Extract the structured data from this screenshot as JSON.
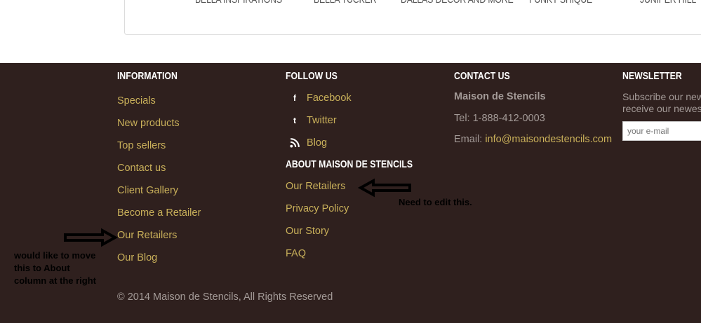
{
  "brands": [
    "BELLA INSPIRATIONS",
    "BELLA TUCKER",
    "DALLAS DECOR AND MORE",
    "FUNKY SHIQUE",
    "JUNIPER HILL"
  ],
  "information": {
    "title": "INFORMATION",
    "links": [
      "Specials",
      "New products",
      "Top sellers",
      "Contact us",
      "Client Gallery",
      "Become a Retailer",
      "Our Retailers",
      "Our Blog"
    ]
  },
  "follow": {
    "title": "FOLLOW US",
    "links": [
      {
        "label": "Facebook",
        "icon": "facebook-icon",
        "glyph": "f"
      },
      {
        "label": "Twitter",
        "icon": "twitter-icon",
        "glyph": "t"
      },
      {
        "label": "Blog",
        "icon": "rss-icon",
        "glyph": "rss"
      }
    ]
  },
  "about": {
    "title": "ABOUT MAISON DE STENCILS",
    "links": [
      "Our Retailers",
      "Privacy Policy",
      "Our Story",
      "FAQ"
    ]
  },
  "contact": {
    "title": "CONTACT US",
    "company": "Maison de Stencils",
    "tel": "Tel: 1-888-412-0003",
    "email_label": "Email:",
    "email": "info@maisondestencils.com"
  },
  "newsletter": {
    "title": "NEWSLETTER",
    "line1": "Subscribe our new",
    "line2": "receive our newes",
    "placeholder": "your e-mail"
  },
  "copyright": "© 2014 Maison de Stencils, All Rights Reserved",
  "annotations": {
    "right_note": "Need to edit this.",
    "left_note": [
      "would like to move",
      "this to About",
      "column at the right"
    ]
  },
  "colors": {
    "footer_bg": "#2f201e",
    "link": "#c9b05a",
    "text": "#a49b98",
    "heading": "#ffffff"
  }
}
